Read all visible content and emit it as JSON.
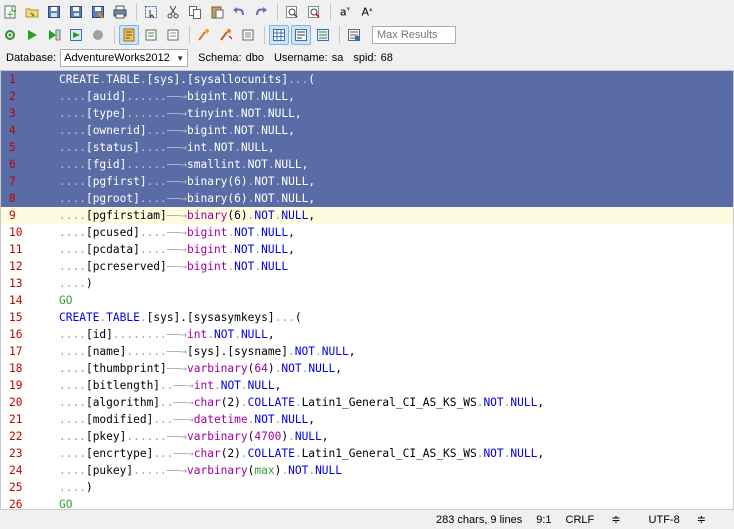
{
  "toolbar": {
    "max_results_placeholder": "Max Results",
    "row1_icons": [
      "new-icon",
      "open-icon",
      "save-icon",
      "save-all-icon",
      "save-as-icon",
      "print-icon",
      "select-icon",
      "cut-icon",
      "copy-icon",
      "paste-icon",
      "undo-icon",
      "redo-icon",
      "find-icon",
      "replace-icon",
      "lowercase-icon",
      "uppercase-icon"
    ],
    "row2_icons": [
      "connect-icon",
      "execute-icon",
      "execute-current-icon",
      "execute-selection-icon",
      "stop-icon",
      "format-icon",
      "comment-icon",
      "uncomment-icon",
      "explain-icon",
      "grid-results-icon",
      "text-results-icon",
      "export-icon",
      "script-icon"
    ]
  },
  "connection": {
    "database_label": "Database:",
    "database_value": "AdventureWorks2012",
    "schema_label": "Schema:",
    "schema_value": "dbo",
    "username_label": "Username:",
    "username_value": "sa",
    "spid_label": "spid:",
    "spid_value": "68"
  },
  "editor": {
    "lines": [
      {
        "n": "1",
        "sel": true,
        "toks": [
          [
            "kw",
            "CREATE"
          ],
          [
            "ws",
            "."
          ],
          [
            "kw",
            "TABLE"
          ],
          [
            "ws",
            "."
          ],
          [
            "nm",
            "[sys].[sysallocunits]"
          ],
          [
            "ws",
            "..."
          ],
          [
            "nm",
            "("
          ]
        ]
      },
      {
        "n": "2",
        "sel": true,
        "toks": [
          [
            "ws",
            "...."
          ],
          [
            "nm",
            "[auid]"
          ],
          [
            "ws",
            "......——→"
          ],
          [
            "ty",
            "bigint"
          ],
          [
            "ws",
            "."
          ],
          [
            "kw",
            "NOT"
          ],
          [
            "ws",
            "."
          ],
          [
            "kw",
            "NULL"
          ],
          [
            "nm",
            ","
          ]
        ]
      },
      {
        "n": "3",
        "sel": true,
        "toks": [
          [
            "ws",
            "...."
          ],
          [
            "nm",
            "[type]"
          ],
          [
            "ws",
            "......——→"
          ],
          [
            "ty",
            "tinyint"
          ],
          [
            "ws",
            "."
          ],
          [
            "kw",
            "NOT"
          ],
          [
            "ws",
            "."
          ],
          [
            "kw",
            "NULL"
          ],
          [
            "nm",
            ","
          ]
        ]
      },
      {
        "n": "4",
        "sel": true,
        "toks": [
          [
            "ws",
            "...."
          ],
          [
            "nm",
            "[ownerid]"
          ],
          [
            "ws",
            "...——→"
          ],
          [
            "ty",
            "bigint"
          ],
          [
            "ws",
            "."
          ],
          [
            "kw",
            "NOT"
          ],
          [
            "ws",
            "."
          ],
          [
            "kw",
            "NULL"
          ],
          [
            "nm",
            ","
          ]
        ]
      },
      {
        "n": "5",
        "sel": true,
        "toks": [
          [
            "ws",
            "...."
          ],
          [
            "nm",
            "[status]"
          ],
          [
            "ws",
            "....——→"
          ],
          [
            "ty",
            "int"
          ],
          [
            "ws",
            "."
          ],
          [
            "kw",
            "NOT"
          ],
          [
            "ws",
            "."
          ],
          [
            "kw",
            "NULL"
          ],
          [
            "nm",
            ","
          ]
        ]
      },
      {
        "n": "6",
        "sel": true,
        "toks": [
          [
            "ws",
            "...."
          ],
          [
            "nm",
            "[fgid]"
          ],
          [
            "ws",
            "......——→"
          ],
          [
            "ty",
            "smallint"
          ],
          [
            "ws",
            "."
          ],
          [
            "kw",
            "NOT"
          ],
          [
            "ws",
            "."
          ],
          [
            "kw",
            "NULL"
          ],
          [
            "nm",
            ","
          ]
        ]
      },
      {
        "n": "7",
        "sel": true,
        "toks": [
          [
            "ws",
            "...."
          ],
          [
            "nm",
            "[pgfirst]"
          ],
          [
            "ws",
            "...——→"
          ],
          [
            "ty",
            "binary"
          ],
          [
            "nm",
            "(6)"
          ],
          [
            "ws",
            "."
          ],
          [
            "kw",
            "NOT"
          ],
          [
            "ws",
            "."
          ],
          [
            "kw",
            "NULL"
          ],
          [
            "nm",
            ","
          ]
        ]
      },
      {
        "n": "8",
        "sel": true,
        "toks": [
          [
            "ws",
            "...."
          ],
          [
            "nm",
            "[pgroot]"
          ],
          [
            "ws",
            "....——→"
          ],
          [
            "ty",
            "binary"
          ],
          [
            "nm",
            "(6)"
          ],
          [
            "ws",
            "."
          ],
          [
            "kw",
            "NOT"
          ],
          [
            "ws",
            "."
          ],
          [
            "kw",
            "NULL"
          ],
          [
            "nm",
            ","
          ]
        ]
      },
      {
        "n": "9",
        "cur": true,
        "toks": [
          [
            "ws",
            "...."
          ],
          [
            "nm",
            "[pgfirstiam]"
          ],
          [
            "ws",
            "——→"
          ],
          [
            "ty",
            "binary"
          ],
          [
            "nm",
            "(6)"
          ],
          [
            "ws",
            "."
          ],
          [
            "kw",
            "NOT"
          ],
          [
            "ws",
            "."
          ],
          [
            "kw",
            "NULL"
          ],
          [
            "nm",
            ","
          ]
        ]
      },
      {
        "n": "10",
        "toks": [
          [
            "ws",
            "...."
          ],
          [
            "nm",
            "[pcused]"
          ],
          [
            "ws",
            "....——→"
          ],
          [
            "ty",
            "bigint"
          ],
          [
            "ws",
            "."
          ],
          [
            "kw",
            "NOT"
          ],
          [
            "ws",
            "."
          ],
          [
            "kw",
            "NULL"
          ],
          [
            "nm",
            ","
          ]
        ]
      },
      {
        "n": "11",
        "toks": [
          [
            "ws",
            "...."
          ],
          [
            "nm",
            "[pcdata]"
          ],
          [
            "ws",
            "....——→"
          ],
          [
            "ty",
            "bigint"
          ],
          [
            "ws",
            "."
          ],
          [
            "kw",
            "NOT"
          ],
          [
            "ws",
            "."
          ],
          [
            "kw",
            "NULL"
          ],
          [
            "nm",
            ","
          ]
        ]
      },
      {
        "n": "12",
        "toks": [
          [
            "ws",
            "...."
          ],
          [
            "nm",
            "[pcreserved]"
          ],
          [
            "ws",
            "——→"
          ],
          [
            "ty",
            "bigint"
          ],
          [
            "ws",
            "."
          ],
          [
            "kw",
            "NOT"
          ],
          [
            "ws",
            "."
          ],
          [
            "kw",
            "NULL"
          ]
        ]
      },
      {
        "n": "13",
        "toks": [
          [
            "ws",
            "...."
          ],
          [
            "nm",
            ")"
          ]
        ]
      },
      {
        "n": "14",
        "toks": [
          [
            "go",
            "GO"
          ]
        ]
      },
      {
        "n": "15",
        "toks": [
          [
            "kw",
            "CREATE"
          ],
          [
            "ws",
            "."
          ],
          [
            "kw",
            "TABLE"
          ],
          [
            "ws",
            "."
          ],
          [
            "nm",
            "[sys].[sysasymkeys]"
          ],
          [
            "ws",
            "..."
          ],
          [
            "nm",
            "("
          ]
        ]
      },
      {
        "n": "16",
        "toks": [
          [
            "ws",
            "...."
          ],
          [
            "nm",
            "[id]"
          ],
          [
            "ws",
            "........——→"
          ],
          [
            "ty",
            "int"
          ],
          [
            "ws",
            "."
          ],
          [
            "kw",
            "NOT"
          ],
          [
            "ws",
            "."
          ],
          [
            "kw",
            "NULL"
          ],
          [
            "nm",
            ","
          ]
        ]
      },
      {
        "n": "17",
        "toks": [
          [
            "ws",
            "...."
          ],
          [
            "nm",
            "[name]"
          ],
          [
            "ws",
            "......——→"
          ],
          [
            "nm",
            "[sys].[sysname]"
          ],
          [
            "ws",
            "."
          ],
          [
            "kw",
            "NOT"
          ],
          [
            "ws",
            "."
          ],
          [
            "kw",
            "NULL"
          ],
          [
            "nm",
            ","
          ]
        ]
      },
      {
        "n": "18",
        "toks": [
          [
            "ws",
            "...."
          ],
          [
            "nm",
            "[thumbprint]"
          ],
          [
            "ws",
            "——→"
          ],
          [
            "ty",
            "varbinary"
          ],
          [
            "nm",
            "("
          ],
          [
            "ty",
            "64"
          ],
          [
            "nm",
            ")"
          ],
          [
            "ws",
            "."
          ],
          [
            "kw",
            "NOT"
          ],
          [
            "ws",
            "."
          ],
          [
            "kw",
            "NULL"
          ],
          [
            "nm",
            ","
          ]
        ]
      },
      {
        "n": "19",
        "toks": [
          [
            "ws",
            "...."
          ],
          [
            "nm",
            "[bitlength]"
          ],
          [
            "ws",
            "..——→"
          ],
          [
            "ty",
            "int"
          ],
          [
            "ws",
            "."
          ],
          [
            "kw",
            "NOT"
          ],
          [
            "ws",
            "."
          ],
          [
            "kw",
            "NULL"
          ],
          [
            "nm",
            ","
          ]
        ]
      },
      {
        "n": "20",
        "toks": [
          [
            "ws",
            "...."
          ],
          [
            "nm",
            "[algorithm]"
          ],
          [
            "ws",
            "..——→"
          ],
          [
            "ty",
            "char"
          ],
          [
            "nm",
            "(2)"
          ],
          [
            "ws",
            "."
          ],
          [
            "kw",
            "COLLATE"
          ],
          [
            "ws",
            "."
          ],
          [
            "nm",
            "Latin1_General_CI_AS_KS_WS"
          ],
          [
            "ws",
            "."
          ],
          [
            "kw",
            "NOT"
          ],
          [
            "ws",
            "."
          ],
          [
            "kw",
            "NULL"
          ],
          [
            "nm",
            ","
          ]
        ]
      },
      {
        "n": "21",
        "toks": [
          [
            "ws",
            "...."
          ],
          [
            "nm",
            "[modified]"
          ],
          [
            "ws",
            "...——→"
          ],
          [
            "ty",
            "datetime"
          ],
          [
            "ws",
            "."
          ],
          [
            "kw",
            "NOT"
          ],
          [
            "ws",
            "."
          ],
          [
            "kw",
            "NULL"
          ],
          [
            "nm",
            ","
          ]
        ]
      },
      {
        "n": "22",
        "toks": [
          [
            "ws",
            "...."
          ],
          [
            "nm",
            "[pkey]"
          ],
          [
            "ws",
            "......——→"
          ],
          [
            "ty",
            "varbinary"
          ],
          [
            "nm",
            "("
          ],
          [
            "ty",
            "4700"
          ],
          [
            "nm",
            ")"
          ],
          [
            "ws",
            "."
          ],
          [
            "kw",
            "NULL"
          ],
          [
            "nm",
            ","
          ]
        ]
      },
      {
        "n": "23",
        "toks": [
          [
            "ws",
            "...."
          ],
          [
            "nm",
            "[encrtype]"
          ],
          [
            "ws",
            "...——→"
          ],
          [
            "ty",
            "char"
          ],
          [
            "nm",
            "(2)"
          ],
          [
            "ws",
            "."
          ],
          [
            "kw",
            "COLLATE"
          ],
          [
            "ws",
            "."
          ],
          [
            "nm",
            "Latin1_General_CI_AS_KS_WS"
          ],
          [
            "ws",
            "."
          ],
          [
            "kw",
            "NOT"
          ],
          [
            "ws",
            "."
          ],
          [
            "kw",
            "NULL"
          ],
          [
            "nm",
            ","
          ]
        ]
      },
      {
        "n": "24",
        "toks": [
          [
            "ws",
            "...."
          ],
          [
            "nm",
            "[pukey]"
          ],
          [
            "ws",
            ".....——→"
          ],
          [
            "ty",
            "varbinary"
          ],
          [
            "nm",
            "("
          ],
          [
            "go",
            "max"
          ],
          [
            "nm",
            ")"
          ],
          [
            "ws",
            "."
          ],
          [
            "kw",
            "NOT"
          ],
          [
            "ws",
            "."
          ],
          [
            "kw",
            "NULL"
          ]
        ]
      },
      {
        "n": "25",
        "toks": [
          [
            "ws",
            "...."
          ],
          [
            "nm",
            ")"
          ]
        ]
      },
      {
        "n": "26",
        "toks": [
          [
            "go",
            "GO"
          ]
        ]
      }
    ]
  },
  "status": {
    "chars": "283 chars, 9 lines",
    "position": "9:1",
    "line_ending": "CRLF",
    "encoding": "UTF-8"
  }
}
